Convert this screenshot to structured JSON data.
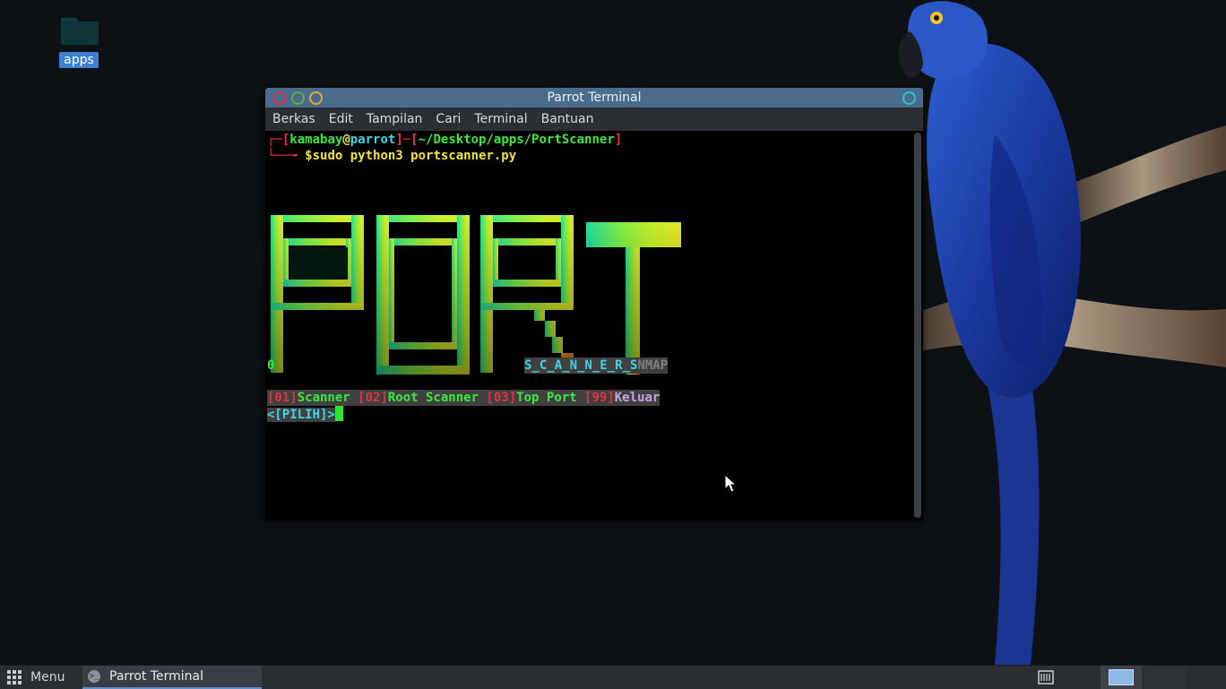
{
  "desktop": {
    "icons": [
      {
        "label": "apps",
        "icon": "folder-icon"
      }
    ]
  },
  "window": {
    "title": "Parrot Terminal",
    "menu": [
      "Berkas",
      "Edit",
      "Tampilan",
      "Cari",
      "Terminal",
      "Bantuan"
    ]
  },
  "terminal": {
    "prompt_corner": "┌─[",
    "user": "kamabay",
    "at": "@",
    "host": "parrot",
    "sep": "]─[",
    "path": "~/Desktop/apps/PortScanner",
    "close": "]",
    "prompt_arrow": "└──╼ ",
    "dollar": "$",
    "command": "sudo python3 portscanner.py",
    "banner_word": "PORT",
    "zero": "0",
    "subtitle": "S_C_A_N_N_E_R_S",
    "subtitle_suffix": "NMAP",
    "options": [
      {
        "code": "[01]",
        "label": "Scanner "
      },
      {
        "code": "[02]",
        "label": "Root Scanner "
      },
      {
        "code": "[03]",
        "label": "Top Port "
      },
      {
        "code": "[99]",
        "label": "Keluar"
      }
    ],
    "input_prompt": "<[PILIH]>"
  },
  "taskbar": {
    "menu_label": "Menu",
    "task_label": "Parrot Terminal",
    "task_icon_glyph": ">_"
  },
  "colors": {
    "accent": "#3d7fd1",
    "titlebar": "#4a6d8e",
    "terminal_bg": "#000000"
  }
}
